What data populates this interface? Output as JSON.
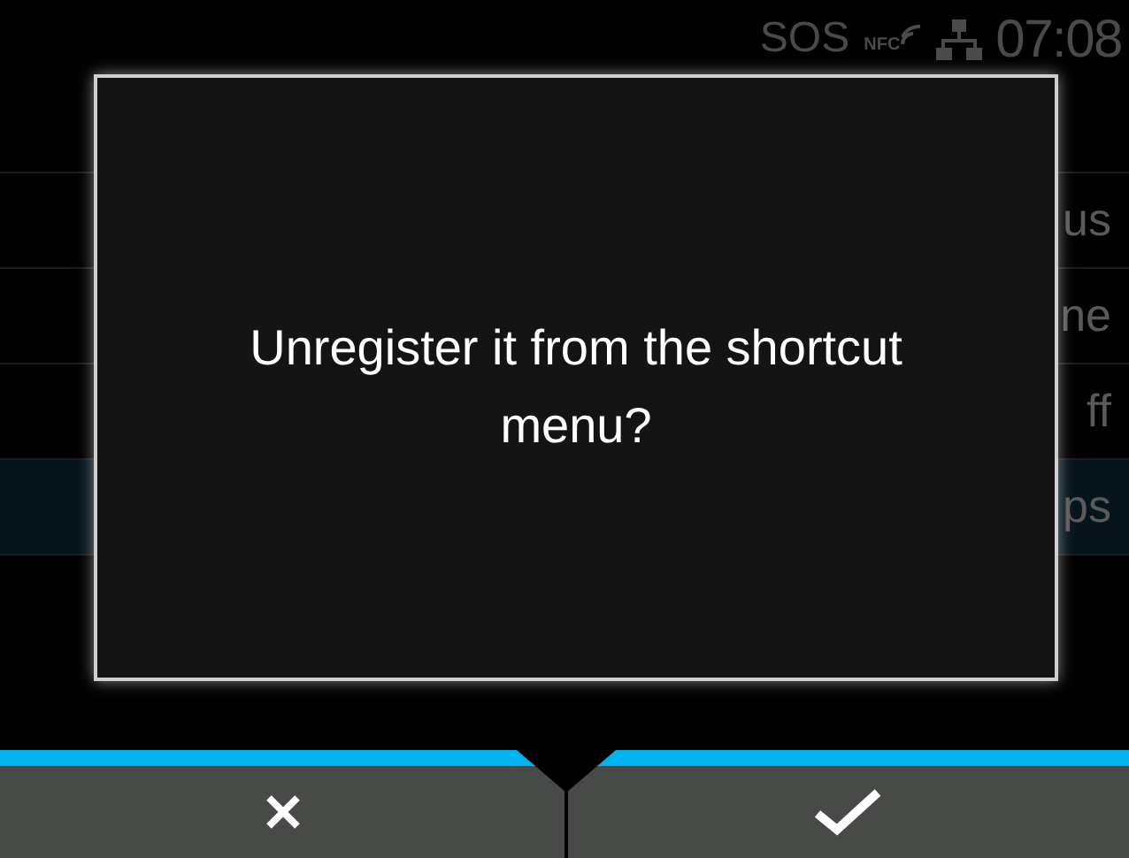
{
  "status_bar": {
    "sos": "SOS",
    "nfc": "NFC",
    "time": "07:08"
  },
  "rows": [
    {
      "value": "us",
      "selected": false
    },
    {
      "value": "ne",
      "selected": false
    },
    {
      "value": "ff",
      "selected": false
    },
    {
      "value": "ps",
      "selected": true
    }
  ],
  "dialog": {
    "message": "Unregister it from the shortcut menu?"
  },
  "buttons": [
    {
      "kind": "cancel"
    },
    {
      "kind": "confirm"
    }
  ]
}
